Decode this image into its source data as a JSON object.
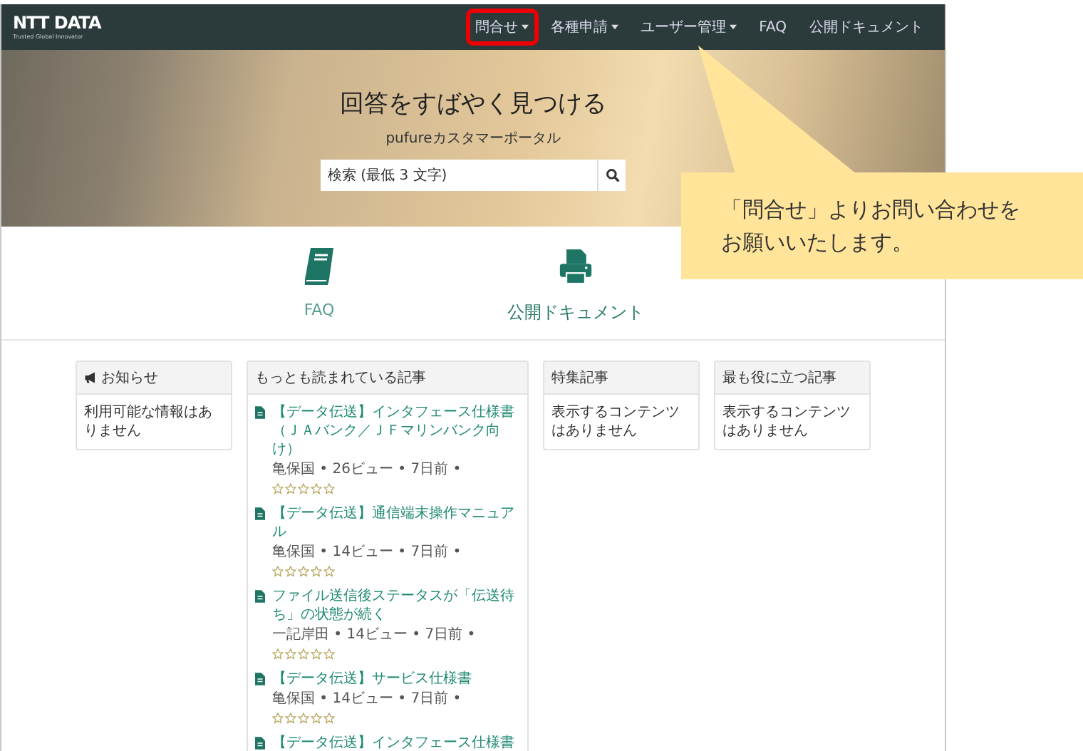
{
  "nav": {
    "logo": "NTT DATA",
    "tagline": "Trusted Global Innovator",
    "items": [
      {
        "label": "問合せ",
        "dropdown": true,
        "highlighted": true
      },
      {
        "label": "各種申請",
        "dropdown": true,
        "highlighted": false
      },
      {
        "label": "ユーザー管理",
        "dropdown": true,
        "highlighted": false
      },
      {
        "label": "FAQ",
        "dropdown": false,
        "highlighted": false
      },
      {
        "label": "公開ドキュメント",
        "dropdown": false,
        "highlighted": false
      }
    ]
  },
  "hero": {
    "title": "回答をすばやく見つける",
    "subtitle": "pufureカスタマーポータル",
    "search": {
      "placeholder": "検索 (最低 3 文字)"
    }
  },
  "shortcuts": [
    {
      "kind": "book",
      "label": "FAQ"
    },
    {
      "kind": "printer",
      "label": "公開ドキュメント"
    }
  ],
  "cards": [
    {
      "kind": "notice",
      "title": "お知らせ",
      "empty_text": "利用可能な情報はありません"
    },
    {
      "kind": "articles",
      "title": "もっとも読まれている記事",
      "articles": [
        {
          "title": "【データ伝送】インタフェース仕様書（ＪＡバンク／ＪＦマリンバンク向け）",
          "meta": "亀保国 • 26ビュー • 7日前 •",
          "stars": 0
        },
        {
          "title": "【データ伝送】通信端末操作マニュアル",
          "meta": "亀保国 • 14ビュー • 7日前 •",
          "stars": 0
        },
        {
          "title": "ファイル送信後ステータスが「伝送待ち」の状態が続く",
          "meta": "一記岸田 • 14ビュー • 7日前 •",
          "stars": 0
        },
        {
          "title": "【データ伝送】サービス仕様書",
          "meta": "亀保国 • 14ビュー • 7日前 •",
          "stars": 0
        },
        {
          "title": "【データ伝送】インタフェース仕様書"
        }
      ]
    },
    {
      "kind": "plain",
      "title": "特集記事",
      "empty_text": "表示するコンテンツはありません"
    },
    {
      "kind": "plain",
      "title": "最も役に立つ記事",
      "empty_text": "表示するコンテンツはありません"
    }
  ],
  "callout": {
    "lines": [
      "「問合せ」よりお問い合わせを",
      "お願いいたします。"
    ]
  }
}
